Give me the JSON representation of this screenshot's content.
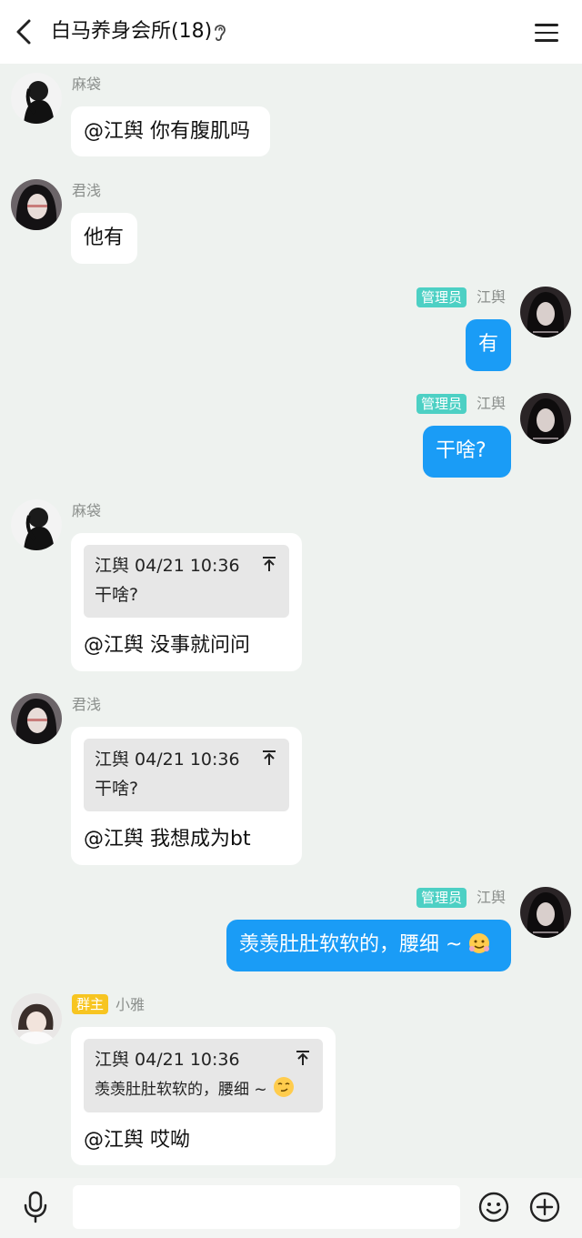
{
  "header": {
    "title": "白马养身会所(18)"
  },
  "messages": [
    {
      "sender": "麻袋",
      "text": "@江舆 你有腹肌吗"
    },
    {
      "sender": "君浅",
      "text": "他有"
    },
    {
      "sender": "江舆",
      "badge": "管理员",
      "text": "有"
    },
    {
      "sender": "江舆",
      "badge": "管理员",
      "text": "干啥?"
    },
    {
      "sender": "麻袋",
      "quote_head": "江舆 04/21 10:36",
      "quote_text": "干啥?",
      "text": "@江舆 没事就问问"
    },
    {
      "sender": "君浅",
      "quote_head": "江舆 04/21 10:36",
      "quote_text": "干啥?",
      "text": "@江舆 我想成为bt"
    },
    {
      "sender": "江舆",
      "badge": "管理员",
      "text": "羡羡肚肚软软的，腰细 ~"
    },
    {
      "sender": "小雅",
      "badge": "群主",
      "quote_head": "江舆 04/21 10:36",
      "quote_text": "羡羡肚肚软软的，腰细 ~",
      "text": "@江舆 哎呦"
    }
  ],
  "colors": {
    "background": "#eef2ef",
    "my_bubble": "#1a9cf6",
    "admin_badge": "#4dd0c4",
    "owner_badge": "#f7c521"
  },
  "icons": [
    "back-arrow-icon",
    "ear-icon",
    "menu-icon",
    "pin-arrow-icon",
    "microphone-icon",
    "emoji-icon",
    "plus-icon"
  ]
}
